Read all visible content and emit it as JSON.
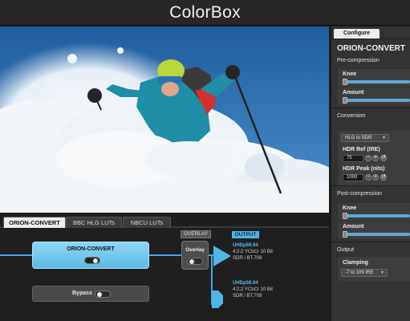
{
  "app": {
    "title": "ColorBox"
  },
  "tabs": [
    {
      "label": "ORION-CONVERT",
      "active": true
    },
    {
      "label": "BBC HLG LUTs",
      "active": false
    },
    {
      "label": "NBCU LUTs",
      "active": false
    }
  ],
  "flow": {
    "processor": {
      "label": "ORION-CONVERT",
      "enabled": true
    },
    "bypass": {
      "label": "Bypass",
      "enabled": false
    },
    "overlay": {
      "header": "OVERLAY",
      "label": "Overlay",
      "enabled": false
    },
    "output": {
      "header": "OUTPUT",
      "primary": {
        "format": "UHDp59.94",
        "sampling": "4:2:2 YCbCr 10 Bit",
        "colorspace": "SDR / BT.709"
      },
      "secondary": {
        "format": "UHDp59.94",
        "sampling": "4:2:2 YCbCr 10 Bit",
        "colorspace": "SDR / BT.709"
      }
    }
  },
  "panel": {
    "tab": "Configure",
    "title": "ORION-CONVERT",
    "pre": {
      "heading": "Pre-compression",
      "knee_label": "Knee",
      "amount_label": "Amount",
      "knee_level": 0.0,
      "amount_level": 0.0
    },
    "conversion": {
      "heading": "Conversion",
      "mode": "HLG to SDR",
      "hdr_ref_label": "HDR Ref (IRE)",
      "hdr_ref_value": "75",
      "hdr_peak_label": "HDR Peak (nits)",
      "hdr_peak_value": "1000"
    },
    "post": {
      "heading": "Post-compression",
      "knee_label": "Knee",
      "amount_label": "Amount",
      "knee_level": 0.0,
      "amount_level": 0.0
    },
    "output": {
      "heading": "Output",
      "clamping_label": "Clamping",
      "clamping_value": "-7 to 109 IRE"
    },
    "icons": {
      "minus": "−",
      "plus": "+",
      "reset": "↺",
      "caret": "▼"
    }
  },
  "colors": {
    "accent": "#4fb4e6",
    "panel": "#333333",
    "background": "#1d1d1d"
  }
}
